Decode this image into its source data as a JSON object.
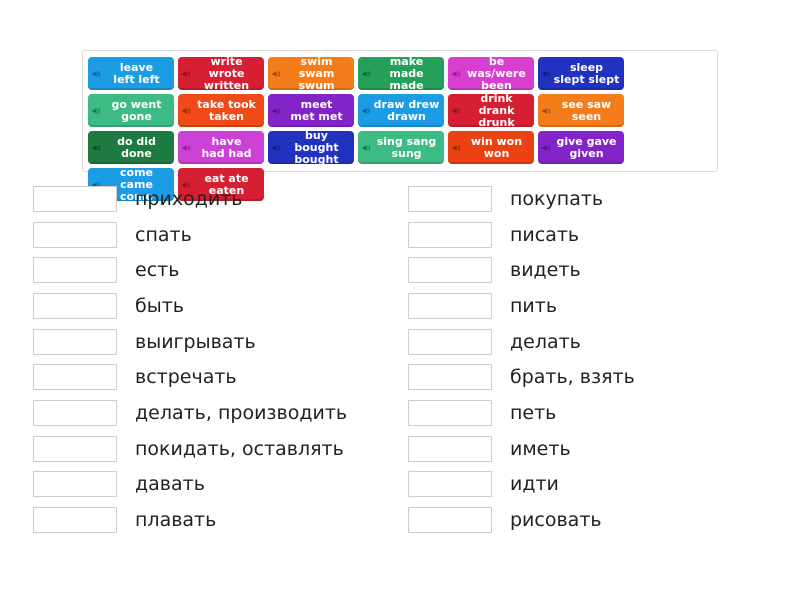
{
  "wordbank": {
    "name": "irregular-verbs-word-bank",
    "audio_icon": "speaker-icon",
    "tiles": [
      {
        "label": "leave\nleft left",
        "text": "leave left left",
        "color": "#1b9ce5"
      },
      {
        "label": "write wrote\nwritten",
        "text": "write wrote written",
        "color": "#d61f32"
      },
      {
        "label": "swim swam\nswum",
        "text": "swim swam swum",
        "color": "#f57c1a"
      },
      {
        "label": "make made\nmade",
        "text": "make made made",
        "color": "#24a05a"
      },
      {
        "label": "be was/were\nbeen",
        "text": "be was/were been",
        "color": "#d83fd0"
      },
      {
        "label": "sleep\nslept slept",
        "text": "sleep slept slept",
        "color": "#2232c0"
      },
      {
        "label": "go went\ngone",
        "text": "go went gone",
        "color": "#3dbb84"
      },
      {
        "label": "take took\ntaken",
        "text": "take took taken",
        "color": "#f04a18"
      },
      {
        "label": "meet\nmet met",
        "text": "meet met met",
        "color": "#8324c8"
      },
      {
        "label": "draw drew\ndrawn",
        "text": "draw drew drawn",
        "color": "#1b9ce5"
      },
      {
        "label": "drink drank\ndrunk",
        "text": "drink drank drunk",
        "color": "#d61f32"
      },
      {
        "label": "see saw\nseen",
        "text": "see saw seen",
        "color": "#f57c1a"
      },
      {
        "label": "do did\ndone",
        "text": "do did done",
        "color": "#1d7a41"
      },
      {
        "label": "have\nhad had",
        "text": "have had had",
        "color": "#cc41d6"
      },
      {
        "label": "buy bought\nbought",
        "text": "buy bought bought",
        "color": "#2232c0"
      },
      {
        "label": "sing sang\nsung",
        "text": "sing sang sung",
        "color": "#3dbb84"
      },
      {
        "label": "win won\nwon",
        "text": "win won won",
        "color": "#ea4215"
      },
      {
        "label": "give gave\ngiven",
        "text": "give gave given",
        "color": "#8324c8"
      },
      {
        "label": "come\ncame come",
        "text": "come came come",
        "color": "#1b9ce5"
      },
      {
        "label": "eat ate\neaten",
        "text": "eat ate eaten",
        "color": "#d61f32"
      }
    ]
  },
  "answers": {
    "left_column": [
      {
        "value": "",
        "label": "приходить"
      },
      {
        "value": "",
        "label": "спать"
      },
      {
        "value": "",
        "label": "есть"
      },
      {
        "value": "",
        "label": "быть"
      },
      {
        "value": "",
        "label": "выигрывать"
      },
      {
        "value": "",
        "label": "встречать"
      },
      {
        "value": "",
        "label": "делать, производить"
      },
      {
        "value": "",
        "label": "покидать, оставлять"
      },
      {
        "value": "",
        "label": "давать"
      },
      {
        "value": "",
        "label": "плавать"
      }
    ],
    "right_column": [
      {
        "value": "",
        "label": "покупать"
      },
      {
        "value": "",
        "label": "писать"
      },
      {
        "value": "",
        "label": "видеть"
      },
      {
        "value": "",
        "label": "пить"
      },
      {
        "value": "",
        "label": "делать"
      },
      {
        "value": "",
        "label": "брать, взять"
      },
      {
        "value": "",
        "label": "петь"
      },
      {
        "value": "",
        "label": "иметь"
      },
      {
        "value": "",
        "label": "идти"
      },
      {
        "value": "",
        "label": "рисовать"
      }
    ]
  },
  "theme": {
    "page_background": "#ffffff",
    "box_border": "#cccccc",
    "wordbank_border": "#dcdcdc",
    "text_color": "#222222"
  }
}
